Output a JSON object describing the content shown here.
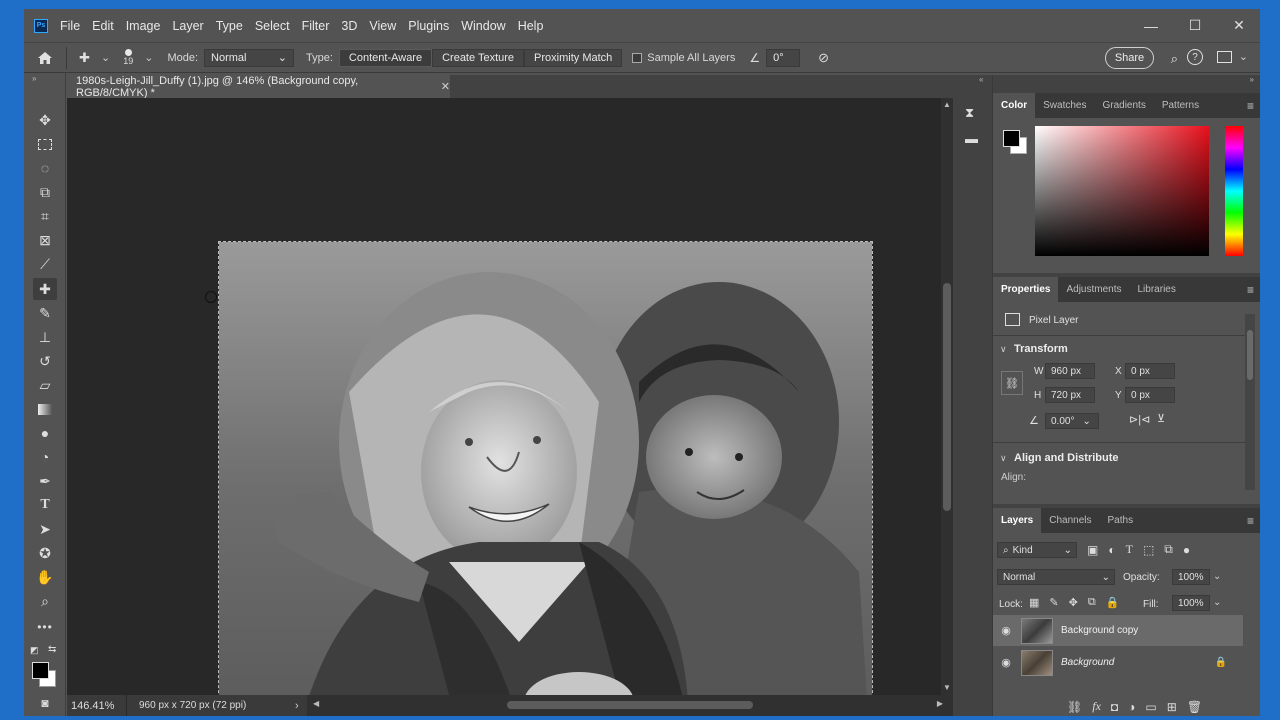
{
  "app": {
    "logo": "Ps"
  },
  "menu": [
    "File",
    "Edit",
    "Image",
    "Layer",
    "Type",
    "Select",
    "Filter",
    "3D",
    "View",
    "Plugins",
    "Window",
    "Help"
  ],
  "options": {
    "brush_size": "19",
    "mode_label": "Mode:",
    "mode_value": "Normal",
    "type_label": "Type:",
    "type_buttons": [
      "Content-Aware",
      "Create Texture",
      "Proximity Match"
    ],
    "sample_all_layers": "Sample All Layers",
    "angle_value": "0°",
    "share": "Share"
  },
  "document": {
    "tab_title": "1980s-Leigh-Jill_Duffy (1).jpg @ 146% (Background copy, RGB/8/CMYK) *",
    "zoom": "146.41%",
    "doc_size": "960 px x 720 px (72 ppi)"
  },
  "color_panel": {
    "tabs": [
      "Color",
      "Swatches",
      "Gradients",
      "Patterns"
    ]
  },
  "properties_panel": {
    "tabs": [
      "Properties",
      "Adjustments",
      "Libraries"
    ],
    "layer_type": "Pixel Layer",
    "transform_title": "Transform",
    "w_label": "W",
    "w_value": "960 px",
    "h_label": "H",
    "h_value": "720 px",
    "x_label": "X",
    "x_value": "0 px",
    "y_label": "Y",
    "y_value": "0 px",
    "angle_value": "0.00°",
    "align_title": "Align and Distribute",
    "align_label": "Align:"
  },
  "layers_panel": {
    "tabs": [
      "Layers",
      "Channels",
      "Paths"
    ],
    "kind": "Kind",
    "blend_mode": "Normal",
    "opacity_label": "Opacity:",
    "opacity_value": "100%",
    "lock_label": "Lock:",
    "fill_label": "Fill:",
    "fill_value": "100%",
    "layers": [
      {
        "name": "Background copy",
        "selected": true
      },
      {
        "name": "Background",
        "selected": false
      }
    ]
  },
  "colors": {
    "accent": "#31a8ff",
    "panel": "#535353",
    "canvas_bg": "#282828"
  }
}
